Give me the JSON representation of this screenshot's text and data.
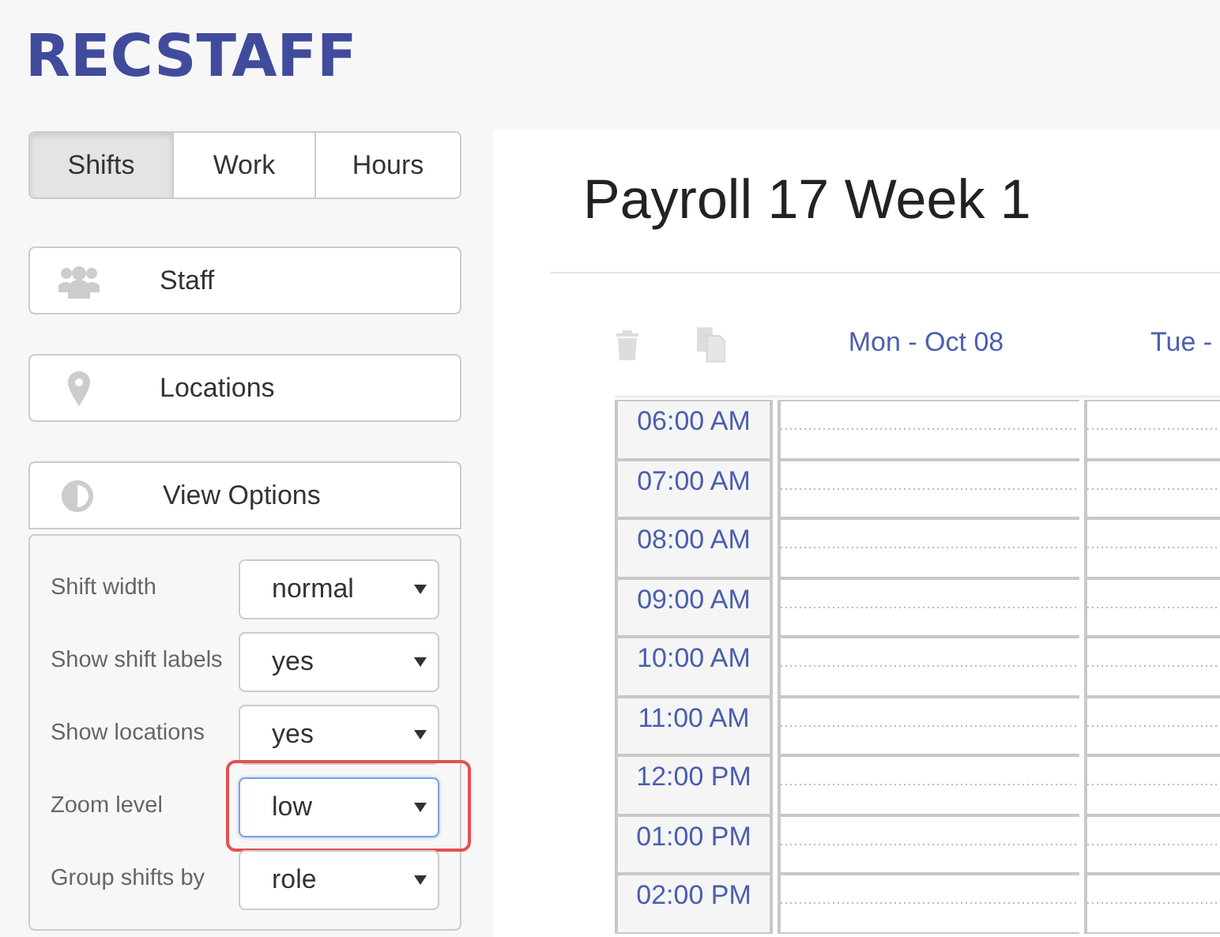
{
  "logo": "RECSTAFF",
  "view_tabs": [
    {
      "label": "Shifts",
      "selected": true
    },
    {
      "label": "Work",
      "selected": false
    },
    {
      "label": "Hours",
      "selected": false
    }
  ],
  "panels": [
    {
      "label": "Staff"
    },
    {
      "label": "Locations"
    },
    {
      "label": "View Options"
    }
  ],
  "view_options": [
    {
      "label": "Shift width",
      "value": "normal",
      "focused": false,
      "highlighted": false
    },
    {
      "label": "Show shift labels",
      "value": "yes",
      "focused": false,
      "highlighted": false
    },
    {
      "label": "Show locations",
      "value": "yes",
      "focused": false,
      "highlighted": false
    },
    {
      "label": "Zoom level",
      "value": "low",
      "focused": true,
      "highlighted": true
    },
    {
      "label": "Group shifts by",
      "value": "role",
      "focused": false,
      "highlighted": false
    }
  ],
  "main": {
    "title": "Payroll 17 Week 1",
    "day_headers": [
      "Mon - Oct 08",
      "Tue -"
    ],
    "time_slots": [
      "06:00 AM",
      "07:00 AM",
      "08:00 AM",
      "09:00 AM",
      "10:00 AM",
      "11:00 AM",
      "12:00 PM",
      "01:00 PM",
      "02:00 PM"
    ]
  }
}
